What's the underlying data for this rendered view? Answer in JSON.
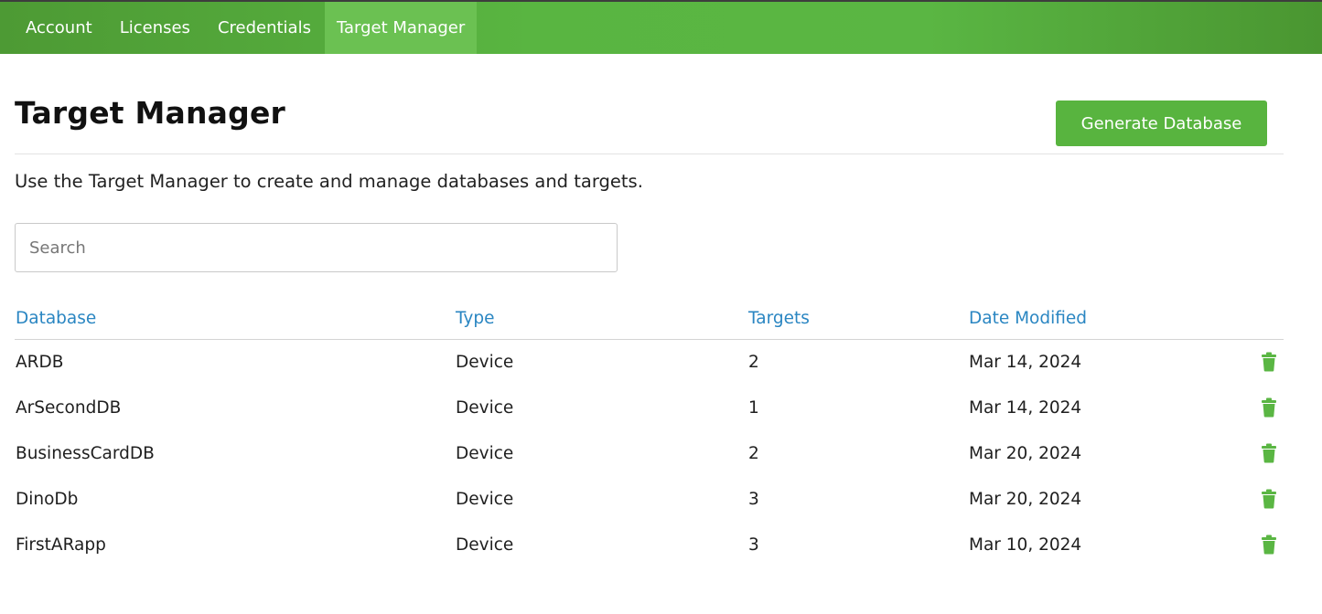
{
  "nav": {
    "items": [
      {
        "label": "Account",
        "active": false
      },
      {
        "label": "Licenses",
        "active": false
      },
      {
        "label": "Credentials",
        "active": false
      },
      {
        "label": "Target Manager",
        "active": true
      }
    ]
  },
  "page": {
    "title": "Target Manager",
    "generate_button_label": "Generate Database",
    "description": "Use the Target Manager to create and manage databases and targets."
  },
  "search": {
    "placeholder": "Search",
    "value": ""
  },
  "table": {
    "headers": {
      "database": "Database",
      "type": "Type",
      "targets": "Targets",
      "date_modified": "Date Modified"
    },
    "rows": [
      {
        "database": "ARDB",
        "type": "Device",
        "targets": "2",
        "date_modified": "Mar 14, 2024"
      },
      {
        "database": "ArSecondDB",
        "type": "Device",
        "targets": "1",
        "date_modified": "Mar 14, 2024"
      },
      {
        "database": "BusinessCardDB",
        "type": "Device",
        "targets": "2",
        "date_modified": "Mar 20, 2024"
      },
      {
        "database": "DinoDb",
        "type": "Device",
        "targets": "3",
        "date_modified": "Mar 20, 2024"
      },
      {
        "database": "FirstARapp",
        "type": "Device",
        "targets": "3",
        "date_modified": "Mar 10, 2024"
      }
    ],
    "row_action_icon": "trash-icon"
  },
  "colors": {
    "nav_green": "#59b541",
    "active_tab": "#6bc152",
    "button_green": "#58b43f",
    "header_link_blue": "#2a86c2",
    "trash_green": "#5ab643"
  }
}
